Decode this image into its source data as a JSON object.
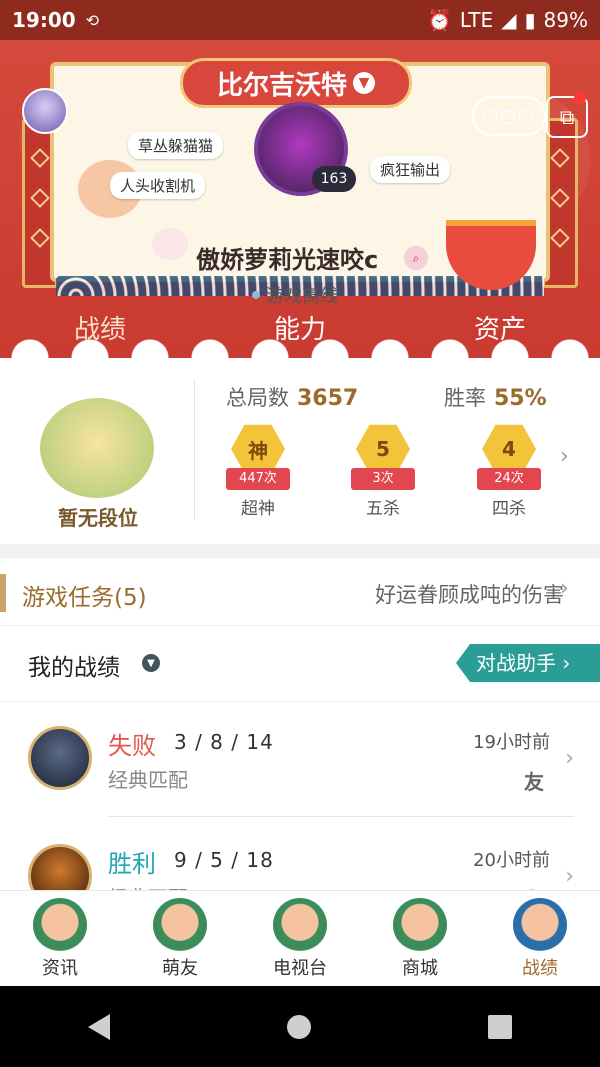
{
  "status": {
    "time": "19:00",
    "network": "LTE",
    "battery": "89%"
  },
  "header": {
    "server": "比尔吉沃特",
    "level": "163",
    "nickname": "傲娇萝莉光速咬c",
    "status": "游戏离线",
    "tags": [
      "草丛躲猫猫",
      "人头收割机",
      "疯狂输出"
    ],
    "menu_dots": "○○○"
  },
  "tabs": [
    "战绩",
    "能力",
    "资产"
  ],
  "stats": {
    "rank_label": "暂无段位",
    "total_label": "总局数",
    "total_value": "3657",
    "winrate_label": "胜率",
    "winrate_value": "55%",
    "medals": [
      {
        "glyph": "神",
        "count": "447次",
        "name": "超神"
      },
      {
        "glyph": "5",
        "count": "3次",
        "name": "五杀"
      },
      {
        "glyph": "4",
        "count": "24次",
        "name": "四杀"
      }
    ]
  },
  "tasks": {
    "title": "游戏任务(5)",
    "desc": "好运眷顾成吨的伤害"
  },
  "my_records": {
    "title": "我的战绩",
    "assistant": "对战助手"
  },
  "records": [
    {
      "result": "失败",
      "result_color": "#e5584f",
      "kda": "3 / 8 / 14",
      "mode": "经典匹配",
      "time": "19小时前",
      "badge": "友"
    },
    {
      "result": "胜利",
      "result_color": "#23a6b5",
      "kda": "9 / 5 / 18",
      "mode": "经典匹配",
      "time": "20小时前",
      "badge": "友"
    }
  ],
  "bottom_nav": [
    "资讯",
    "萌友",
    "电视台",
    "商城",
    "战绩"
  ],
  "icons": {
    "back": "back-icon",
    "home": "home-icon",
    "recents": "recents-icon"
  }
}
